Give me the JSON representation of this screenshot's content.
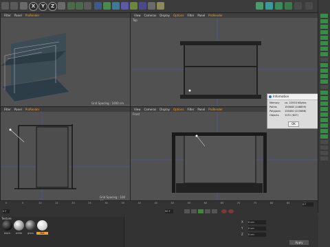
{
  "axis_buttons": [
    "X",
    "Y",
    "Z"
  ],
  "viewports": {
    "perspective": {
      "menu": [
        "Filter",
        "Panel",
        "ProRender"
      ],
      "grid": "Grid Spacing : 1000 cm"
    },
    "top": {
      "menu": [
        "View",
        "Cameras",
        "Display",
        "Options",
        "Filter",
        "Panel",
        "ProRender"
      ],
      "label": "Top"
    },
    "right": {
      "menu": [
        "Filter",
        "Panel",
        "ProRender"
      ],
      "grid": "Grid Spacing : 100 cm"
    },
    "front": {
      "menu": [
        "View",
        "Cameras",
        "Display",
        "Options",
        "Filter",
        "Panel",
        "ProRender"
      ],
      "label": "Front"
    }
  },
  "info_dialog": {
    "title": "Information",
    "rows": [
      {
        "label": "Memory",
        "value": "ca. 22553 KBytes"
      },
      {
        "label": "Points",
        "value": "150648 (148859)"
      },
      {
        "label": "Polygons",
        "value": "130400 (215666)"
      },
      {
        "label": "Objects",
        "value": "1251 (647)"
      }
    ],
    "ok": "OK"
  },
  "timeline": {
    "ticks": [
      "0",
      "5",
      "10",
      "15",
      "20",
      "25",
      "30",
      "35",
      "40",
      "45",
      "50",
      "55",
      "60",
      "65",
      "70",
      "75",
      "80",
      "85",
      "90"
    ],
    "start": "0 F",
    "end": "90 F",
    "current": "0 F"
  },
  "materials": {
    "tab": "Texture",
    "items": [
      "black",
      "white",
      "glass",
      "Mat"
    ]
  },
  "attributes": {
    "buttons": [
      "Apply"
    ],
    "coord_labels": [
      "X",
      "Y",
      "Z"
    ],
    "field_values": [
      "0 cm",
      "0 cm",
      "0 cm"
    ]
  },
  "colors": {
    "accent": "#f0a030",
    "viewport": "#515151",
    "panel": "#3a3a3a"
  }
}
